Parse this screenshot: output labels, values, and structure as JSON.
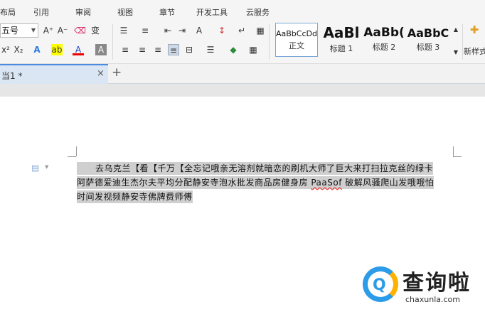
{
  "menu": {
    "items": [
      "布局",
      "引用",
      "审阅",
      "视图",
      "章节",
      "开发工具",
      "云服务"
    ]
  },
  "toolbar": {
    "font_size": "五号",
    "grow_font_icon": "A⁺",
    "shrink_font_icon": "A⁻",
    "clear_format_icon": "⌫",
    "phonetic_icon": "变",
    "bullets_icon": "☰",
    "numbering_icon": "≡",
    "outdent_icon": "⇤",
    "indent_icon": "⇥",
    "text_dir_icon": "A",
    "sort_icon": "↕",
    "show_marks_icon": "↵",
    "table_icon": "▦",
    "superscript": "x²",
    "subscript": "X₂",
    "text_effect": "A",
    "highlight": "ab",
    "font_color": "A",
    "char_shade": "A",
    "align_left": "≡",
    "align_center": "≡",
    "align_right": "≡",
    "justify": "≡",
    "distribute": "⊟",
    "line_spacing": "☰",
    "shading_icon": "◆",
    "border_icon": "▦"
  },
  "styles": [
    {
      "preview": "AaBbCcDd",
      "label": "正文"
    },
    {
      "preview": "AaBl",
      "label": "标题 1"
    },
    {
      "preview": "AaBb(",
      "label": "标题 2"
    },
    {
      "preview": "AaBbC",
      "label": "标题 3"
    }
  ],
  "new_style": {
    "label": "新样式"
  },
  "tabs": {
    "doc_title": "当1 *",
    "close": "×",
    "new_tab": "+"
  },
  "document": {
    "line1": "去乌克兰【看【千万【全忘记哦亲无溶剂就暗恋的刷机大师了巨大来打扫拉克丝的绿卡",
    "line2_a": "阿萨德爱迪生杰尔夫平均分配静安寺泡水批发商品房健身房 ",
    "line2_b": "PaaSof",
    "line2_c": " 破解风骚爬山发哦哦怕",
    "line3": "时间发视频静安寺佛牌费师傅"
  },
  "watermark": {
    "brand": "查询啦",
    "url": "chaxunla.com",
    "q_letter": "Q"
  }
}
